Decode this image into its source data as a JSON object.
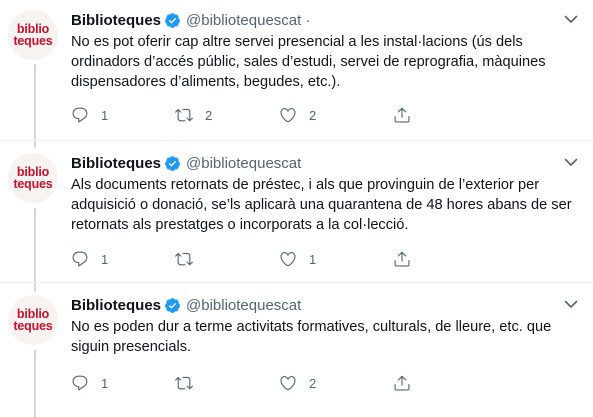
{
  "account": {
    "name": "Biblioteques",
    "handle": "@bibliotequescat",
    "separator": "·",
    "avatar": {
      "line1": "biblio",
      "line2": "teques",
      "color": "#c8102e"
    }
  },
  "tweets": [
    {
      "text": "No es pot oferir cap altre servei presencial a les instal·lacions (ús dels\nordinadors d’accés públic, sales d’estudi, servei de reprografia, màquines\ndispensadores d’aliments, begudes, etc.).",
      "replies": "1",
      "retweets": "2",
      "likes": "2"
    },
    {
      "text": "Als documents retornats de préstec, i als que provinguin de l’exterior per\nadquisició o donació, se’ls aplicarà una quarantena de 48 hores abans de ser\nretornats als prestatges o incorporats a la col·lecció.",
      "replies": "1",
      "retweets": "",
      "likes": "1"
    },
    {
      "text": "No es poden dur a terme activitats  formatives, culturals, de lleure, etc. que\nsiguin presencials.",
      "replies": "1",
      "retweets": "",
      "likes": "2"
    }
  ],
  "icons": {
    "verified": "verified-badge-icon",
    "more": "more-icon",
    "reply": "reply-icon",
    "retweet": "retweet-icon",
    "like": "like-icon",
    "share": "share-icon"
  },
  "colors": {
    "verified": "#1d9bf0",
    "muted": "#536471",
    "text": "#0f1419",
    "rail": "#cfd9de"
  }
}
